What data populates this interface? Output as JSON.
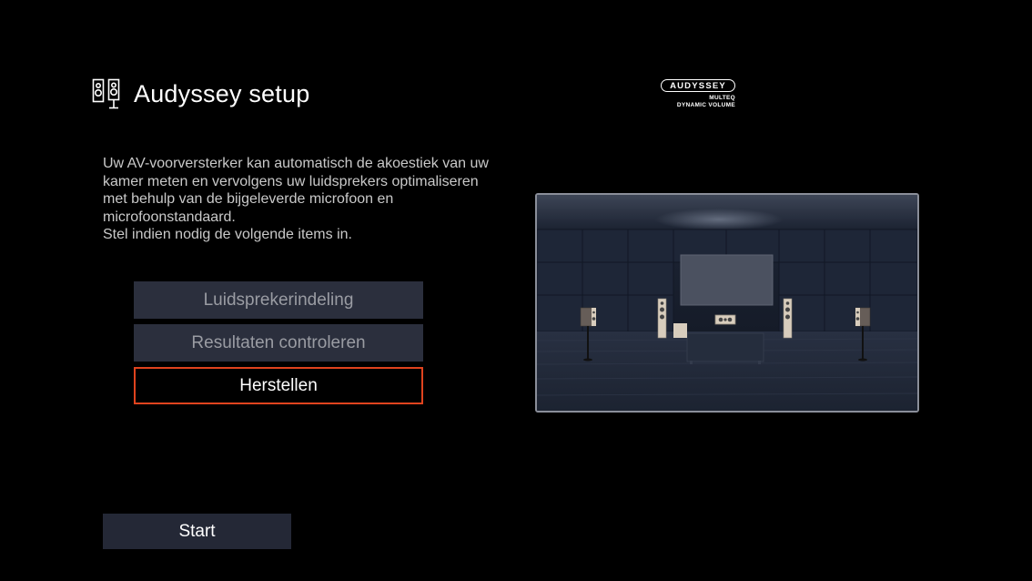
{
  "header": {
    "title": "Audyssey setup",
    "title_icon": "speaker-pair-icon"
  },
  "logo": {
    "brand": "AUDYSSEY",
    "line1": "MULTEQ",
    "line2": "DYNAMIC VOLUME"
  },
  "description": {
    "lines": [
      "Uw AV-voorversterker kan automatisch de akoestiek van uw kamer meten en vervolgens uw luidsprekers optimaliseren met behulp van de bijgeleverde microfoon en microfoonstandaard.",
      "Stel indien nodig de volgende items in."
    ]
  },
  "menu": {
    "items": [
      {
        "label": "Luidsprekerindeling",
        "selected": false
      },
      {
        "label": "Resultaten controleren",
        "selected": false
      },
      {
        "label": "Herstellen",
        "selected": true
      }
    ]
  },
  "start": {
    "label": "Start"
  },
  "colors": {
    "background": "#000000",
    "menu_item_bg": "#2b2f3d",
    "menu_item_text": "#9a9ca3",
    "selection_border": "#e0431e",
    "start_bg": "#242836",
    "description_text": "#c9c9c9"
  }
}
